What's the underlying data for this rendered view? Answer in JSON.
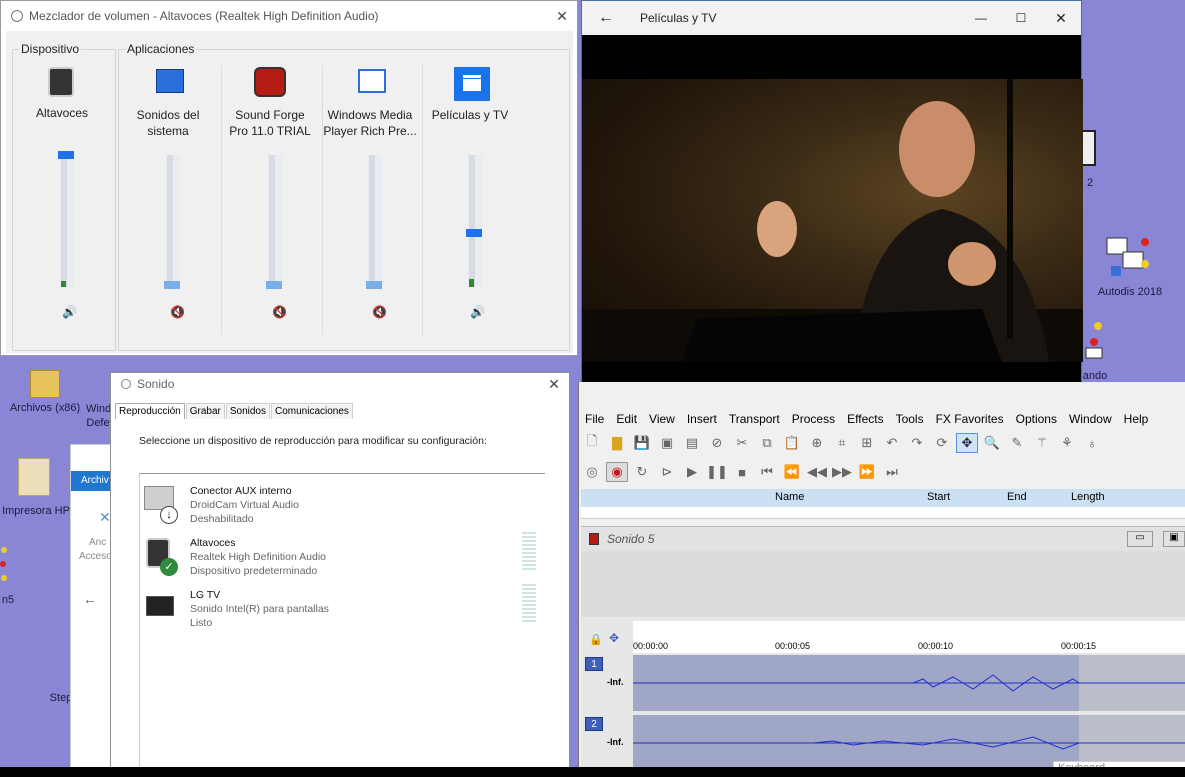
{
  "desktop": {
    "icons": [
      {
        "label": "Archivos (x86)"
      },
      {
        "label": "Wind Defe"
      },
      {
        "label": "Impresora HP"
      },
      {
        "label": "n5"
      },
      {
        "label": "Step"
      },
      {
        "label": "2"
      },
      {
        "label": "Autodis 2018"
      },
      {
        "label": "ando"
      }
    ]
  },
  "mixer": {
    "title": "Mezclador de volumen - Altavoces (Realtek High Definition Audio)",
    "device_group": "Dispositivo",
    "apps_group": "Aplicaciones",
    "channels": [
      {
        "label_line1": "Altavoces",
        "label_line2": "",
        "level": 1.0,
        "muted": false
      },
      {
        "label_line1": "Sonidos del",
        "label_line2": "sistema",
        "level": 0.0,
        "muted": true
      },
      {
        "label_line1": "Sound Forge",
        "label_line2": "Pro 11.0 TRIAL",
        "level": 0.0,
        "muted": true
      },
      {
        "label_line1": "Windows Media",
        "label_line2": "Player Rich Pre...",
        "level": 0.0,
        "muted": true
      },
      {
        "label_line1": "Películas y TV",
        "label_line2": "",
        "level": 0.39,
        "muted": false
      }
    ]
  },
  "movies": {
    "title": "Películas y TV"
  },
  "sound": {
    "title": "Sonido",
    "tabs": [
      "Reproducción",
      "Grabar",
      "Sonidos",
      "Comunicaciones"
    ],
    "instruction": "Seleccione un dispositivo de reproducción para modificar su configuración:",
    "devices": [
      {
        "name": "Conector AUX interno",
        "line2": "DroidCam Virtual Audio",
        "status": "Deshabilitado"
      },
      {
        "name": "Altavoces",
        "line2": "Realtek High Definition Audio",
        "status": "Dispositivo predeterminado"
      },
      {
        "name": "LG TV",
        "line2": "Sonido Intel(R) para pantallas",
        "status": "Listo"
      }
    ]
  },
  "explorer_fragment": {
    "tab": "Archiv",
    "item1": "Anc",
    "item2": "Acceso"
  },
  "soundforge": {
    "menu": [
      "File",
      "Edit",
      "View",
      "Insert",
      "Transport",
      "Process",
      "Effects",
      "Tools",
      "FX Favorites",
      "Options",
      "Window",
      "Help"
    ],
    "columns": [
      "Name",
      "Start",
      "End",
      "Length"
    ],
    "document": "Sonido 5",
    "timeline": [
      "00:00:00",
      "00:00:05",
      "00:00:10",
      "00:00:15"
    ],
    "channels": [
      {
        "num": "1",
        "db": "-Inf."
      },
      {
        "num": "2",
        "db": "-Inf."
      }
    ],
    "keyboard": "Keyboard"
  }
}
